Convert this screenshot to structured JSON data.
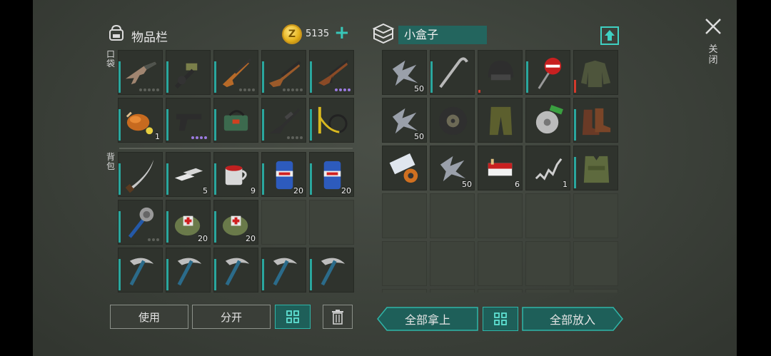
{
  "inventory": {
    "title": "物品栏",
    "coins": "5135",
    "coin_symbol": "Z",
    "plus": "+",
    "pocket_label": "口袋",
    "backpack_label": "背包",
    "pocket_items": [
      {
        "icon": "assault-rifle-icon",
        "qty": "",
        "dots": 5,
        "dot_color": "gray"
      },
      {
        "icon": "grenade-launcher-icon",
        "qty": "",
        "dots": 0
      },
      {
        "icon": "hunting-rifle-icon",
        "qty": "",
        "dots": 4,
        "dot_color": "gray"
      },
      {
        "icon": "shotgun-icon",
        "qty": "",
        "dots": 5,
        "dot_color": "gray"
      },
      {
        "icon": "ak-rifle-icon",
        "qty": "",
        "dots": 4,
        "dot_color": "purple"
      },
      {
        "icon": "roast-chicken-icon",
        "qty": "1",
        "dots": 0
      },
      {
        "icon": "pistol-icon",
        "qty": "",
        "dots": 4,
        "dot_color": "purple"
      },
      {
        "icon": "bomb-bag-icon",
        "qty": "",
        "dots": 0
      },
      {
        "icon": "sniper-rifle-icon",
        "qty": "",
        "dots": 4,
        "dot_color": "gray"
      },
      {
        "icon": "crossbow-icon",
        "qty": "",
        "dots": 0
      }
    ],
    "backpack_items": [
      {
        "icon": "machete-icon",
        "qty": "",
        "dots": 0
      },
      {
        "icon": "metal-ingots-icon",
        "qty": "5",
        "dots": 0
      },
      {
        "icon": "red-mug-icon",
        "qty": "9",
        "dots": 0
      },
      {
        "icon": "beer-can-icon",
        "qty": "20",
        "dots": 0
      },
      {
        "icon": "beer-can-icon",
        "qty": "20",
        "dots": 0
      },
      {
        "icon": "spiked-mace-icon",
        "qty": "",
        "dots": 3,
        "dot_color": "gray"
      },
      {
        "icon": "first-aid-bag-icon",
        "qty": "20",
        "dots": 0
      },
      {
        "icon": "first-aid-bag-icon",
        "qty": "20",
        "dots": 0
      },
      {
        "icon": "",
        "qty": "",
        "dots": 0
      },
      {
        "icon": "",
        "qty": "",
        "dots": 0
      },
      {
        "icon": "pickaxe-icon",
        "qty": "",
        "dots": 0
      },
      {
        "icon": "pickaxe-icon",
        "qty": "",
        "dots": 0
      },
      {
        "icon": "pickaxe-icon",
        "qty": "",
        "dots": 0
      },
      {
        "icon": "pickaxe-icon",
        "qty": "",
        "dots": 0
      },
      {
        "icon": "pickaxe-icon",
        "qty": "",
        "dots": 0
      }
    ],
    "buttons": {
      "use": "使用",
      "split": "分开"
    }
  },
  "container": {
    "title": "小盒子",
    "items": [
      {
        "icon": "scrap-metal-icon",
        "qty": "50",
        "bar": "none"
      },
      {
        "icon": "crowbar-icon",
        "qty": "",
        "bar": "teal"
      },
      {
        "icon": "helmet-icon",
        "qty": "",
        "bar": "red-small"
      },
      {
        "icon": "stop-sign-icon",
        "qty": "",
        "bar": "teal"
      },
      {
        "icon": "jacket-icon",
        "qty": "",
        "bar": "red"
      },
      {
        "icon": "scrap-metal-icon",
        "qty": "50",
        "bar": "none"
      },
      {
        "icon": "tire-icon",
        "qty": "",
        "bar": "none"
      },
      {
        "icon": "pants-icon",
        "qty": "",
        "bar": "none"
      },
      {
        "icon": "saw-blade-icon",
        "qty": "",
        "bar": "none"
      },
      {
        "icon": "boots-icon",
        "qty": "",
        "bar": "teal"
      },
      {
        "icon": "tape-icon",
        "qty": "",
        "bar": "none"
      },
      {
        "icon": "scrap-metal-icon",
        "qty": "50",
        "bar": "none"
      },
      {
        "icon": "cigarettes-icon",
        "qty": "6",
        "bar": "none"
      },
      {
        "icon": "spring-icon",
        "qty": "1",
        "bar": "none"
      },
      {
        "icon": "vest-icon",
        "qty": "",
        "bar": "teal"
      }
    ],
    "buttons": {
      "take_all": "全部拿上",
      "put_all": "全部放入"
    }
  },
  "close": {
    "label": "关闭"
  },
  "colors": {
    "accent": "#2fb5a8",
    "accent_dark": "#1e5f59",
    "durability_red": "#d33a2c"
  }
}
